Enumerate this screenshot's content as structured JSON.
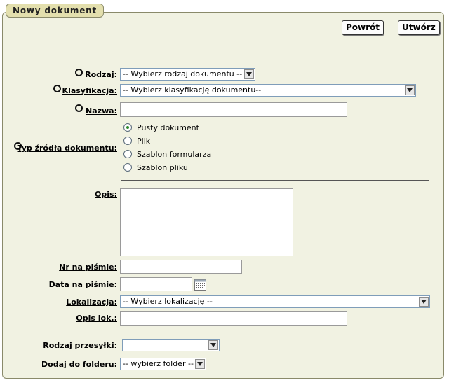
{
  "panel": {
    "title": "Nowy dokument"
  },
  "toolbar": {
    "back_label": "Powrót",
    "create_label": "Utwórz"
  },
  "form": {
    "rodzaj": {
      "label": "Rodzaj:",
      "value": "-- Wybierz rodzaj dokumentu --"
    },
    "klasyfikacja": {
      "label": "Klasyfikacja:",
      "value": "-- Wybierz klasyfikację dokumentu--"
    },
    "nazwa": {
      "label": "Nazwa:",
      "value": ""
    },
    "typ_zrodla": {
      "label": "Typ źródła dokumentu:",
      "options": [
        "Pusty dokument",
        "Plik",
        "Szablon formularza",
        "Szablon pliku"
      ],
      "selected": "Pusty dokument"
    },
    "opis": {
      "label": "Opis:",
      "value": ""
    },
    "nr_na_pismie": {
      "label": "Nr na piśmie:",
      "value": ""
    },
    "data_na_pismie": {
      "label": "Data na piśmie:",
      "value": ""
    },
    "lokalizacja": {
      "label": "Lokalizacja:",
      "value": "-- Wybierz lokalizację --"
    },
    "opis_lok": {
      "label": "Opis lok.:",
      "value": ""
    },
    "rodzaj_przesylki": {
      "label": "Rodzaj przesyłki:",
      "value": ""
    },
    "dodaj_do_folderu": {
      "label": "Dodaj do folderu:",
      "value": "-- wybierz folder --"
    }
  },
  "icons": {
    "calendar": "calendar-icon",
    "dropdown": "chevron-down-icon",
    "required": "required-marker-icon"
  }
}
